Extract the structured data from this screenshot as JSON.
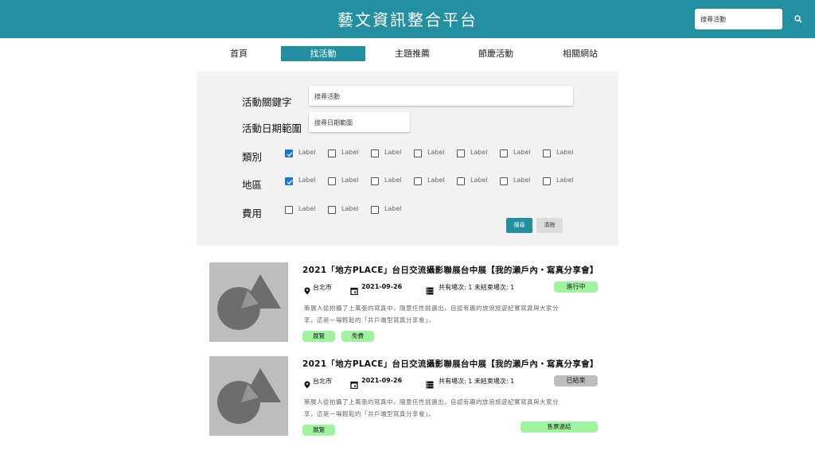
{
  "header": {
    "title": "藝文資訊整合平台",
    "search_placeholder": "搜尋活動"
  },
  "nav": [
    "首頁",
    "找活動",
    "主題推薦",
    "節慶活動",
    "相關網站"
  ],
  "filters": {
    "keyword_label": "活動關鍵字",
    "keyword_placeholder": "搜尋活動",
    "date_label": "活動日期範圍",
    "date_placeholder": "搜尋日期範圍",
    "category_label": "類別",
    "region_label": "地區",
    "fee_label": "費用",
    "checkbox_label": "Label",
    "search_button": "搜尋",
    "clear_button": "清除"
  },
  "events": [
    {
      "title": "2021「地方PLACE」台日交流攝影聯展台中展【我的瀨戶內・寫真分享會】",
      "location": "台北市",
      "date": "2021-09-26",
      "sessions": "共有場次: 1  未結束場次: 1",
      "status": "進行中",
      "desc_line1": "策展人從拍攝了上萬張的寫真中，隨意任性挑選出，自認有趣的放浪旅遊紀實寫真與大家分",
      "desc_line2": "享，這是一場輕鬆的「井戶端型寫真分享會」。",
      "tags": [
        "展覽",
        "免費"
      ]
    },
    {
      "title": "2021「地方PLACE」台日交流攝影聯展台中展【我的瀨戶內・寫真分享會】",
      "location": "台北市",
      "date": "2021-09-26",
      "sessions": "共有場次: 1  未結束場次: 1",
      "status": "已結束",
      "desc_line1": "策展人從拍攝了上萬張的寫真中，隨意任性挑選出，自認有趣的放浪旅遊紀實寫真與大家分",
      "desc_line2": "享，這是一場輕鬆的「井戶端型寫真分享會」。",
      "tags": [
        "展覽"
      ],
      "ticket_link": "售票連結"
    }
  ],
  "colors": {
    "primary": "#2290a0",
    "tag_green": "#9ff59f",
    "ended_gray": "#bdbdbd",
    "panel": "#f2f2f2"
  }
}
